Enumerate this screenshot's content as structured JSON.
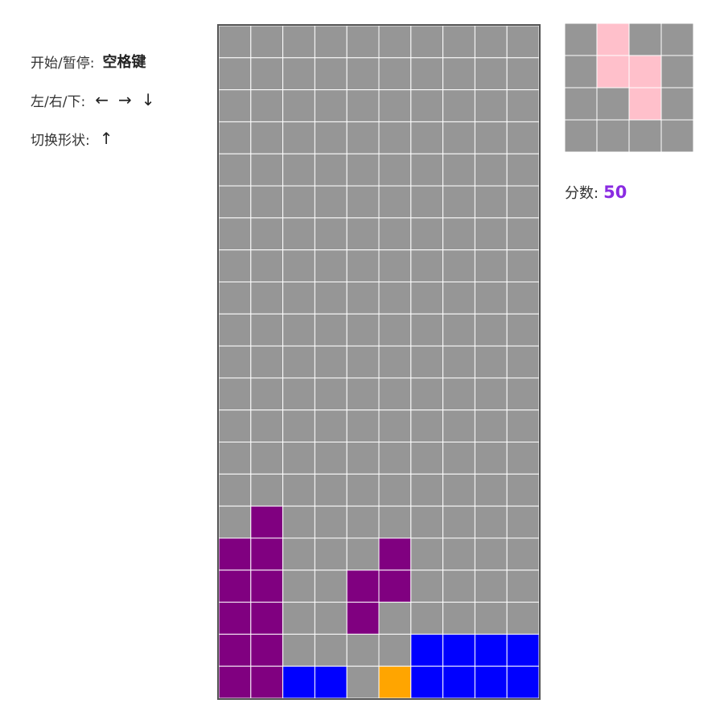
{
  "controls": {
    "pause": {
      "label": "开始/暂停:",
      "key": "空格键"
    },
    "move": {
      "label": "左/右/下:",
      "left": "←",
      "right": "→",
      "down": "↓"
    },
    "rotate": {
      "label": "切换形状:",
      "key": "↑"
    }
  },
  "score": {
    "label": "分数:",
    "value": "50"
  },
  "colors": {
    "empty": "#969696",
    "grid_line": "#ffffff",
    "purple": "#800080",
    "blue": "#0000ff",
    "orange": "#ffa500",
    "pink": "#ffc0cb",
    "score_value": "#8a2be2"
  },
  "board": {
    "columns": 10,
    "rows": 21,
    "cells": [
      "..........",
      "..........",
      "..........",
      "..........",
      "..........",
      "..........",
      "..........",
      "..........",
      "..........",
      "..........",
      "..........",
      "..........",
      "..........",
      "..........",
      "..........",
      ".P........",
      "PP...P....",
      "PP..PP....",
      "PP..P.....",
      "PP....BBBB",
      "PPBB.OBBBB"
    ]
  },
  "next_piece": {
    "columns": 4,
    "rows": 4,
    "cells": [
      ".K..",
      ".KK.",
      "..K.",
      "...."
    ]
  }
}
